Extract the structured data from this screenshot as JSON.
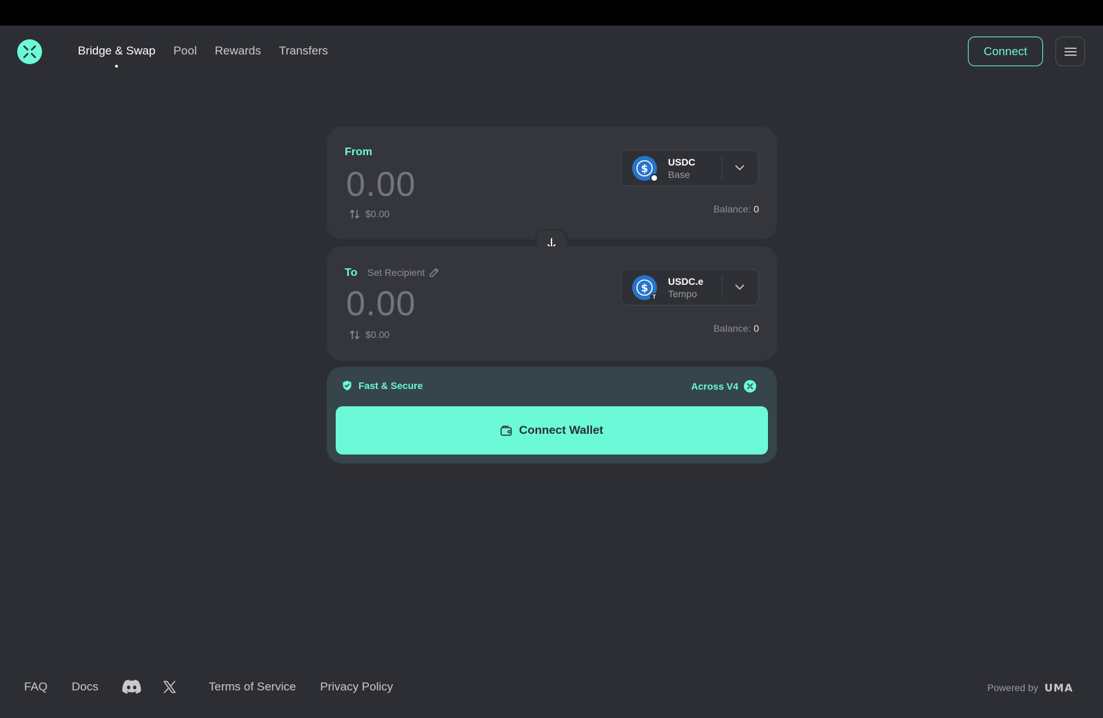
{
  "nav": {
    "items": [
      {
        "label": "Bridge & Swap",
        "active": true
      },
      {
        "label": "Pool"
      },
      {
        "label": "Rewards"
      },
      {
        "label": "Transfers"
      }
    ],
    "connect_label": "Connect"
  },
  "from": {
    "label": "From",
    "amount": "0.00",
    "usd": "$0.00",
    "token": {
      "symbol": "USDC",
      "chain": "Base",
      "icon": "usdc-icon"
    },
    "balance_label": "Balance:",
    "balance_value": "0"
  },
  "to": {
    "label": "To",
    "set_recipient": "Set Recipient",
    "amount": "0.00",
    "usd": "$0.00",
    "token": {
      "symbol": "USDC.e",
      "chain": "Tempo",
      "icon": "usdc-icon"
    },
    "balance_label": "Balance:",
    "balance_value": "0"
  },
  "action": {
    "secure_label": "Fast & Secure",
    "protocol_label": "Across V4",
    "connect_wallet_label": "Connect Wallet"
  },
  "footer": {
    "faq": "FAQ",
    "docs": "Docs",
    "terms": "Terms of Service",
    "privacy": "Privacy Policy",
    "powered_by": "Powered by",
    "powered_brand": "UMA"
  },
  "colors": {
    "accent": "#6cf9d8",
    "background": "#2d2e33",
    "card": "#35363c",
    "usdc_blue": "#2775ca"
  }
}
